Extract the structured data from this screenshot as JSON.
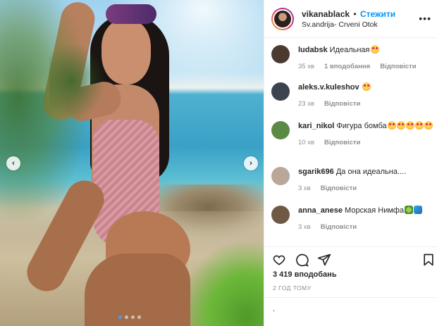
{
  "post": {
    "owner": "vikanablack",
    "separator": "•",
    "follow_label": "Стежити",
    "location": "Sv.andrija- Crveni Otok",
    "more_label": "•••",
    "carousel": {
      "slide_count": 4,
      "active_index": 0,
      "prev_label": "‹",
      "next_label": "›"
    }
  },
  "comments": [
    {
      "user": "ludabsk",
      "text": "Идеальная",
      "emojis": [
        "heart-eyes"
      ],
      "age": "35 хв",
      "likes": "1 вподобання",
      "reply": "Відповісти",
      "avatar_color": "#4b3a30"
    },
    {
      "user": "aleks.v.kuleshov",
      "text": "",
      "emojis": [
        "heart-eyes"
      ],
      "age": "23 хв",
      "likes": "",
      "reply": "Відповісти",
      "avatar_color": "#3c4450"
    },
    {
      "user": "kari_nikol",
      "text": "Фигура бомба",
      "emojis": [
        "heart-eyes",
        "heart-eyes",
        "heart-eyes",
        "heart-eyes",
        "heart-eyes"
      ],
      "age": "10 хв",
      "likes": "",
      "reply": "Відповісти",
      "avatar_color": "#5c8a45"
    },
    {
      "user": "sgarik696",
      "text": "Да она идеальна....",
      "emojis": [],
      "age": "3 хв",
      "likes": "",
      "reply": "Відповісти",
      "avatar_color": "#b9a89a"
    },
    {
      "user": "anna_anese",
      "text": "Морская Нимфа",
      "emojis": [
        "fairy",
        "water-wave"
      ],
      "age": "3 хв",
      "likes": "",
      "reply": "Відповісти",
      "avatar_color": "#6e5a44"
    }
  ],
  "actions": {
    "like_icon": "heart-outline-icon",
    "comment_icon": "comment-bubble-icon",
    "share_icon": "paper-plane-icon",
    "save_icon": "bookmark-icon",
    "comment_like_icon": "heart-outline-icon"
  },
  "stats": {
    "likes_count": "3 419 вподобань",
    "posted_time": "2 ГОД ТОМУ"
  },
  "composer": {
    "value": "."
  }
}
